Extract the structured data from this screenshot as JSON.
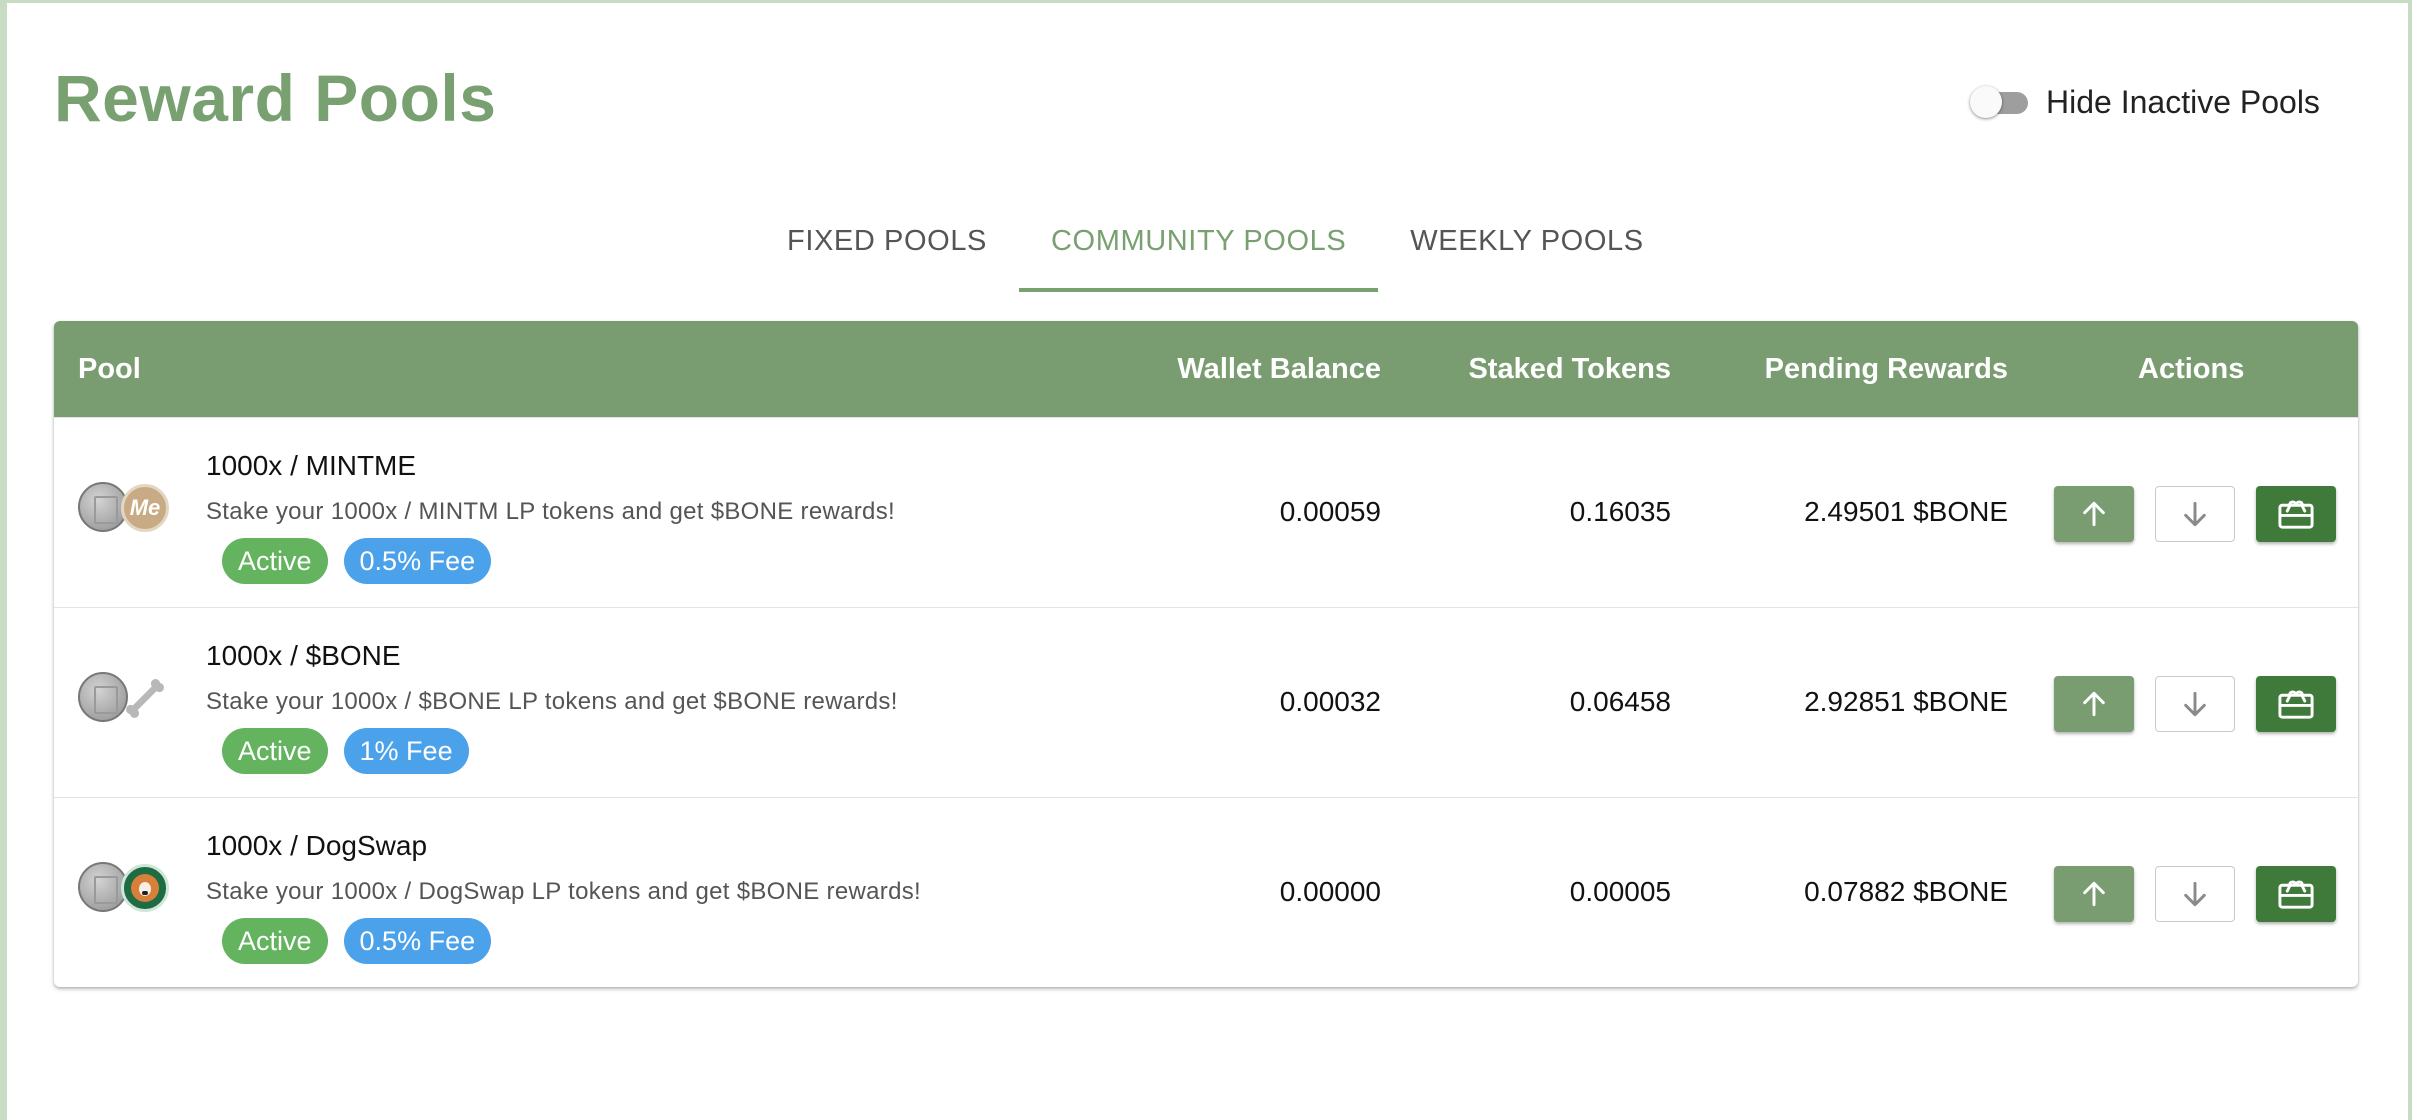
{
  "page": {
    "title": "Reward Pools"
  },
  "toggle": {
    "label": "Hide Inactive Pools",
    "on": false
  },
  "tabs": [
    {
      "label": "FIXED POOLS",
      "active": false
    },
    {
      "label": "COMMUNITY POOLS",
      "active": true
    },
    {
      "label": "WEEKLY POOLS",
      "active": false
    }
  ],
  "table": {
    "headers": {
      "pool": "Pool",
      "wallet": "Wallet Balance",
      "staked": "Staked Tokens",
      "pending": "Pending Rewards",
      "actions": "Actions"
    },
    "rows": [
      {
        "name": "1000x / MINTME",
        "description": "Stake your 1000x / MINTM LP tokens and get $BONE rewards!",
        "status": "Active",
        "fee": "0.5% Fee",
        "wallet": "0.00059",
        "staked": "0.16035",
        "pending": "2.49501 $BONE",
        "token_icons": [
          "1000x-coin-icon",
          "mintme-coin-icon"
        ],
        "token2_text": "Me"
      },
      {
        "name": "1000x / $BONE",
        "description": "Stake your 1000x / $BONE LP tokens and get $BONE rewards!",
        "status": "Active",
        "fee": "1% Fee",
        "wallet": "0.00032",
        "staked": "0.06458",
        "pending": "2.92851 $BONE",
        "token_icons": [
          "1000x-coin-icon",
          "bone-icon"
        ]
      },
      {
        "name": "1000x / DogSwap",
        "description": "Stake your 1000x / DogSwap LP tokens and get $BONE rewards!",
        "status": "Active",
        "fee": "0.5% Fee",
        "wallet": "0.00000",
        "staked": "0.00005",
        "pending": "0.07882 $BONE",
        "token_icons": [
          "1000x-coin-icon",
          "dogswap-coin-icon"
        ]
      }
    ]
  },
  "colors": {
    "accent": "#78a070",
    "header_bg": "#799d70",
    "active_chip": "#63b35f",
    "fee_chip": "#4ba2ea",
    "claim_button": "#3f7a3a"
  }
}
